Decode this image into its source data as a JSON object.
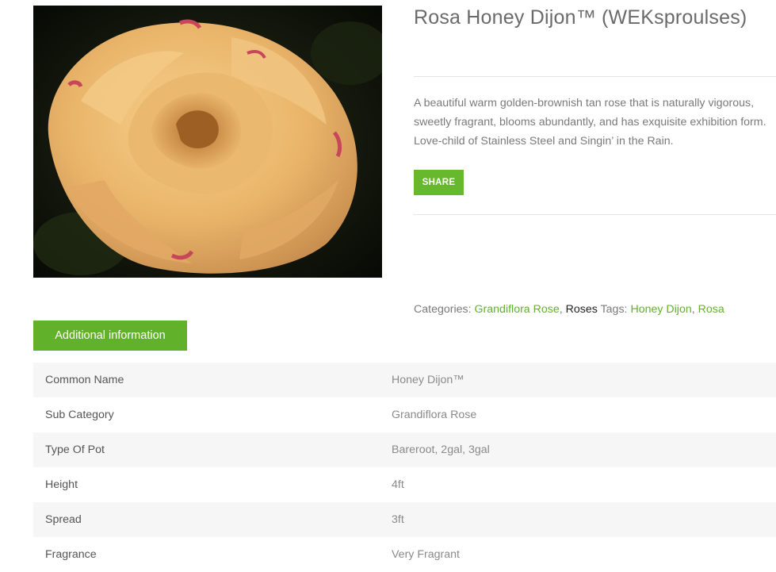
{
  "product": {
    "title": "Rosa Honey Dijon™ (WEKsproulses)",
    "description": "A beautiful warm golden-brownish tan rose that is naturally vigorous, sweetly fragrant, blooms abundantly, and has exquisite exhibition form. Love-child of Stainless Steel and Singin’ in the Rain.",
    "share_label": "SHARE"
  },
  "meta": {
    "categories_label": "Categories:",
    "categories": [
      "Grandiflora Rose",
      "Roses"
    ],
    "tags_label": "Tags:",
    "tags": [
      "Honey Dijon",
      "Rosa"
    ],
    "separator": ","
  },
  "additional_info": {
    "tab_label": "Additional information",
    "rows": [
      {
        "key": "Common Name",
        "value": "Honey Dijon™"
      },
      {
        "key": "Sub Category",
        "value": "Grandiflora Rose"
      },
      {
        "key": "Type Of Pot",
        "value": "Bareroot, 2gal, 3gal"
      },
      {
        "key": "Height",
        "value": "4ft"
      },
      {
        "key": "Spread",
        "value": "3ft"
      },
      {
        "key": "Fragrance",
        "value": "Very Fragrant"
      }
    ]
  },
  "colors": {
    "accent": "#62b12a",
    "row_alt": "#f6f6f6"
  }
}
